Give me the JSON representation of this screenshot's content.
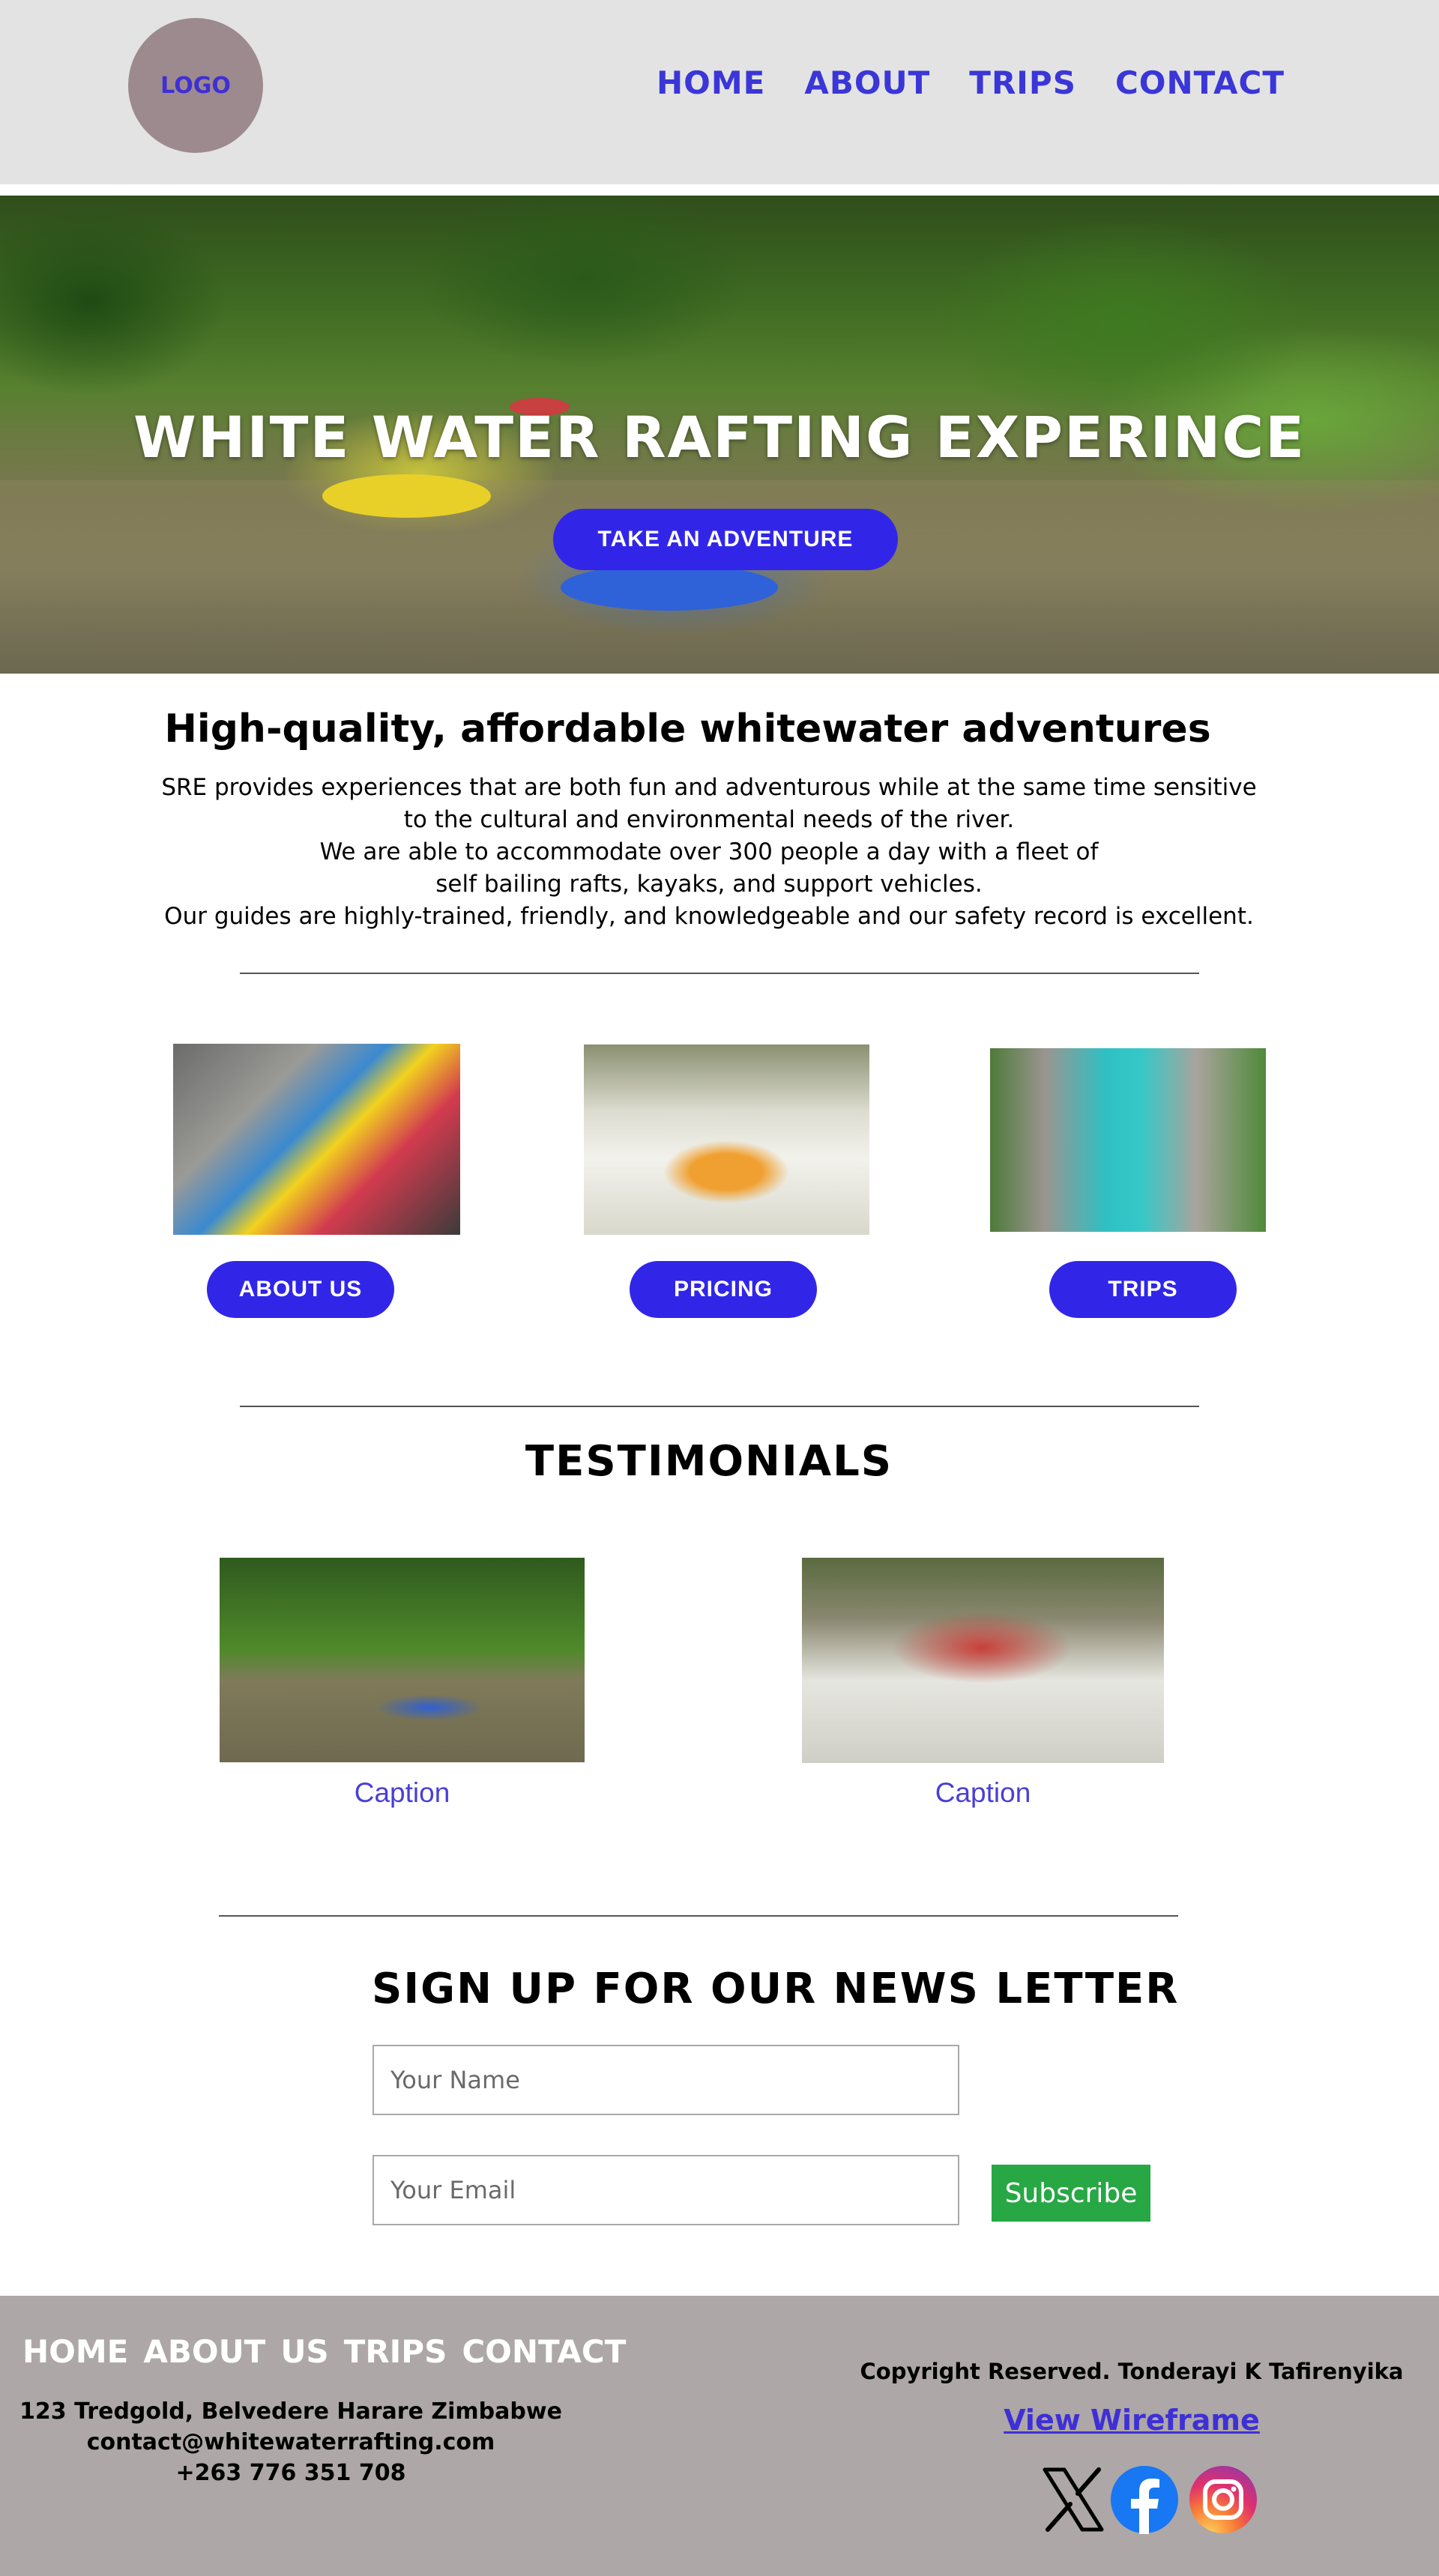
{
  "header": {
    "logo": "LOGO",
    "nav": [
      "HOME",
      "ABOUT",
      "TRIPS",
      "CONTACT"
    ]
  },
  "hero": {
    "title": "WHITE WATER RAFTING EXPERINCE",
    "button": "TAKE AN ADVENTURE"
  },
  "intro": {
    "title": "High-quality, affordable whitewater adventures",
    "lines": [
      "SRE provides experiences that are both fun and adventurous while at the same time sensitive",
      "to the cultural and environmental needs of the river.",
      "We are able to accommodate over 300 people a day with a fleet of",
      "self bailing rafts, kayaks, and support vehicles.",
      "Our guides are highly-trained, friendly, and knowledgeable and our safety record is excellent."
    ]
  },
  "cards": [
    {
      "button": "ABOUT US",
      "image": "paddle-splash-image"
    },
    {
      "button": "PRICING",
      "image": "raft-rapids-image"
    },
    {
      "button": "TRIPS",
      "image": "turquoise-river-gorge-image"
    }
  ],
  "testimonials": {
    "title": "TESTIMONIALS",
    "items": [
      {
        "caption": "Caption",
        "image": "calm-river-rafts-image"
      },
      {
        "caption": "Caption",
        "image": "whitewater-group-image"
      }
    ]
  },
  "newsletter": {
    "title": "SIGN UP FOR OUR NEWS LETTER",
    "name_placeholder": "Your Name",
    "email_placeholder": "Your Email",
    "subscribe": "Subscribe"
  },
  "footer": {
    "nav": [
      "HOME",
      "ABOUT",
      "US",
      "TRIPS",
      "CONTACT"
    ],
    "address": [
      "123 Tredgold, Belvedere Harare Zimbabwe",
      "contact@whitewaterrafting.com",
      "+263 776 351 708"
    ],
    "copyright": "Copyright Reserved. Tonderayi K Tafirenyika",
    "wireframe_link": "View Wireframe",
    "social_icons": [
      "x-icon",
      "facebook-icon",
      "instagram-icon"
    ]
  },
  "colors": {
    "accent": "#3126e8",
    "nav_link": "#3a36d8",
    "header_bg": "#e3e3e3",
    "footer_bg": "#ada7a7",
    "subscribe_bg": "#28a745"
  }
}
